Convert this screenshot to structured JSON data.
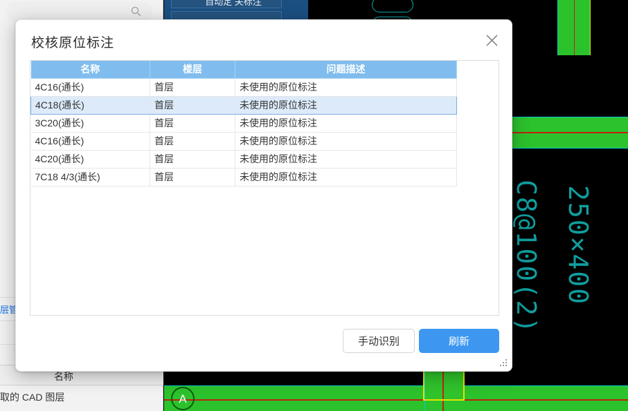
{
  "background": {
    "search": {
      "icon": "search-icon",
      "placeholder": ""
    },
    "link_text": "层管",
    "column_header": "名称",
    "cad_layer_text": "取的 CAD 图层",
    "ribbon_title": "自动定 关标注",
    "cad_labels": {
      "stirrup": "C8@100(2)",
      "section": "250×400",
      "grid_marker": "A"
    },
    "colors": {
      "cad_cyan": "#11a8a8",
      "beam_green": "#2cc22c",
      "red_axis": "#c21f10",
      "selection_yellow": "#e8e200",
      "panel_blue": "#1b4f82"
    }
  },
  "dialog": {
    "title": "校核原位标注",
    "close_icon": "close-icon",
    "resize_icon": "resize-grip-icon",
    "table": {
      "headers": [
        "名称",
        "楼层",
        "问题描述"
      ],
      "rows": [
        {
          "name": "4C16(通长)",
          "floor": "首层",
          "desc": "未使用的原位标注",
          "selected": false
        },
        {
          "name": "4C18(通长)",
          "floor": "首层",
          "desc": "未使用的原位标注",
          "selected": true
        },
        {
          "name": "3C20(通长)",
          "floor": "首层",
          "desc": "未使用的原位标注",
          "selected": false
        },
        {
          "name": "4C16(通长)",
          "floor": "首层",
          "desc": "未使用的原位标注",
          "selected": false
        },
        {
          "name": "4C20(通长)",
          "floor": "首层",
          "desc": "未使用的原位标注",
          "selected": false
        },
        {
          "name": "7C18 4/3(通长)",
          "floor": "首层",
          "desc": "未使用的原位标注",
          "selected": false
        }
      ]
    },
    "buttons": {
      "secondary_label": "手动识别",
      "primary_label": "刷新"
    },
    "colors": {
      "header_bg": "#80bdee",
      "selected_row_bg": "#dceafa",
      "primary_button_bg": "#3d97f0"
    }
  }
}
